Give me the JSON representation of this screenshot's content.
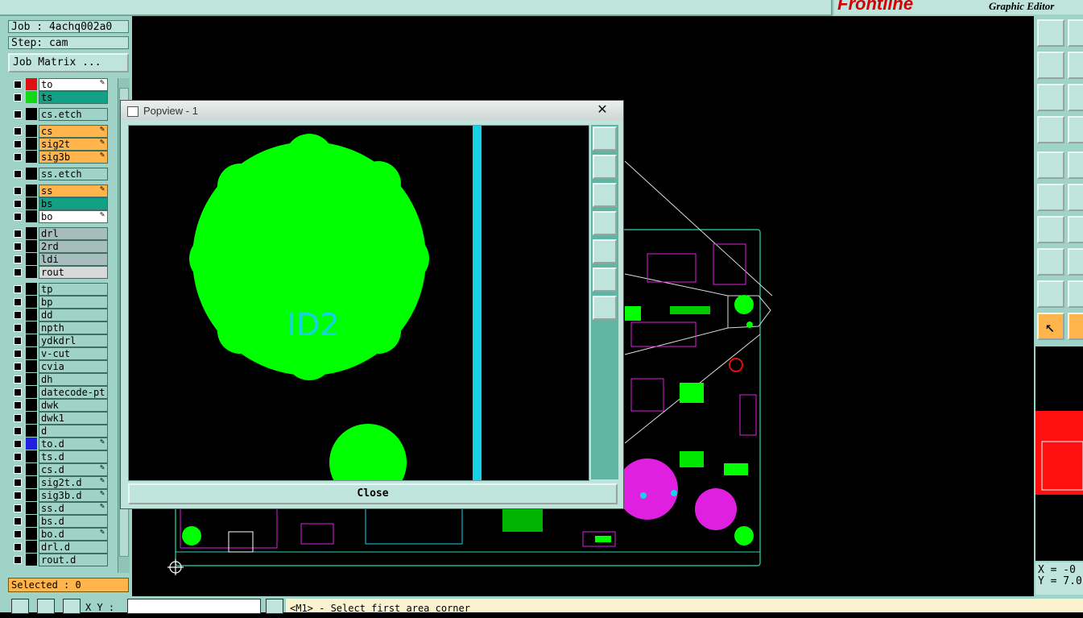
{
  "brand": {
    "logo_text": "Frontline",
    "tagline": "Graphic Editor"
  },
  "job": {
    "job_label": "Job : 4achq002a0",
    "step_label": "Step: cam",
    "matrix_button": "Job Matrix ..."
  },
  "layers": [
    {
      "name": "to",
      "color": "#ffffff",
      "swatch": "#e01010",
      "editable": true
    },
    {
      "name": "ts",
      "color": "#12a086",
      "swatch": "#15d815",
      "editable": false
    },
    {
      "name": "cs.etch",
      "color": "#9fd3c7",
      "swatch": "#000000",
      "editable": false
    },
    {
      "name": "cs",
      "color": "#ffb54c",
      "swatch": "#000000",
      "editable": true
    },
    {
      "name": "sig2t",
      "color": "#ffb54c",
      "swatch": "#000000",
      "editable": true
    },
    {
      "name": "sig3b",
      "color": "#ffb54c",
      "swatch": "#000000",
      "editable": true
    },
    {
      "name": "ss.etch",
      "color": "#9fd3c7",
      "swatch": "#000000",
      "editable": false
    },
    {
      "name": "ss",
      "color": "#ffb54c",
      "swatch": "#000000",
      "editable": true
    },
    {
      "name": "bs",
      "color": "#12a086",
      "swatch": "#000000",
      "editable": false
    },
    {
      "name": "bo",
      "color": "#ffffff",
      "swatch": "#000000",
      "editable": true
    },
    {
      "name": "drl",
      "color": "#a7bcbc",
      "swatch": "#000000",
      "editable": false
    },
    {
      "name": "2rd",
      "color": "#a7bcbc",
      "swatch": "#000000",
      "editable": false
    },
    {
      "name": "ldi",
      "color": "#a7bcbc",
      "swatch": "#000000",
      "editable": false
    },
    {
      "name": "rout",
      "color": "#d8d8d8",
      "swatch": "#000000",
      "editable": false
    },
    {
      "name": "tp",
      "color": "#9fd3c7",
      "swatch": "#000000",
      "editable": false
    },
    {
      "name": "bp",
      "color": "#9fd3c7",
      "swatch": "#000000",
      "editable": false
    },
    {
      "name": "dd",
      "color": "#9fd3c7",
      "swatch": "#000000",
      "editable": false
    },
    {
      "name": "npth",
      "color": "#9fd3c7",
      "swatch": "#000000",
      "editable": false
    },
    {
      "name": "ydkdrl",
      "color": "#9fd3c7",
      "swatch": "#000000",
      "editable": false
    },
    {
      "name": "v-cut",
      "color": "#9fd3c7",
      "swatch": "#000000",
      "editable": false
    },
    {
      "name": "cvia",
      "color": "#9fd3c7",
      "swatch": "#000000",
      "editable": false
    },
    {
      "name": "dh",
      "color": "#9fd3c7",
      "swatch": "#000000",
      "editable": false
    },
    {
      "name": "datecode-pt",
      "color": "#9fd3c7",
      "swatch": "#000000",
      "editable": false
    },
    {
      "name": "dwk",
      "color": "#9fd3c7",
      "swatch": "#000000",
      "editable": false
    },
    {
      "name": "dwk1",
      "color": "#9fd3c7",
      "swatch": "#000000",
      "editable": false
    },
    {
      "name": "d",
      "color": "#9fd3c7",
      "swatch": "#000000",
      "editable": false
    },
    {
      "name": "to.d",
      "color": "#9fd3c7",
      "swatch": "#2020e0",
      "editable": true
    },
    {
      "name": "ts.d",
      "color": "#9fd3c7",
      "swatch": "#000000",
      "editable": false
    },
    {
      "name": "cs.d",
      "color": "#9fd3c7",
      "swatch": "#000000",
      "editable": true
    },
    {
      "name": "sig2t.d",
      "color": "#9fd3c7",
      "swatch": "#000000",
      "editable": true
    },
    {
      "name": "sig3b.d",
      "color": "#9fd3c7",
      "swatch": "#000000",
      "editable": true
    },
    {
      "name": "ss.d",
      "color": "#9fd3c7",
      "swatch": "#000000",
      "editable": true
    },
    {
      "name": "bs.d",
      "color": "#9fd3c7",
      "swatch": "#000000",
      "editable": false
    },
    {
      "name": "bo.d",
      "color": "#9fd3c7",
      "swatch": "#000000",
      "editable": true
    },
    {
      "name": "drl.d",
      "color": "#9fd3c7",
      "swatch": "#000000",
      "editable": false
    },
    {
      "name": "rout.d",
      "color": "#9fd3c7",
      "swatch": "#000000",
      "editable": false
    }
  ],
  "selected_label": "Selected : 0",
  "bottom": {
    "xy_label": "X Y :",
    "message": "<M1> - Select first area corner"
  },
  "coords": {
    "x": "X = -0",
    "y": "Y = 7.0"
  },
  "popview": {
    "title": "Popview - 1",
    "close_label": "Close",
    "pad_text": "ID2"
  },
  "colors": {
    "panel": "#9fd3c7",
    "pad": "#00ff00",
    "accent_orange": "#ffb54c",
    "magenta": "#e020e0",
    "cyan": "#19d1e6"
  }
}
